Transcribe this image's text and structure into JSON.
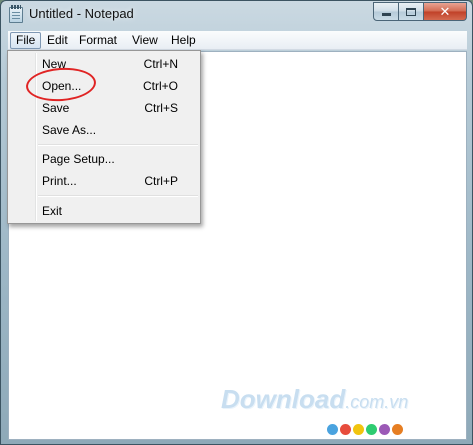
{
  "window": {
    "title": "Untitled - Notepad",
    "close_glyph": "✕"
  },
  "menubar": {
    "items": [
      "File",
      "Edit",
      "Format",
      "View",
      "Help"
    ],
    "active": "File"
  },
  "file_menu": {
    "items": [
      {
        "label": "New",
        "shortcut": "Ctrl+N"
      },
      {
        "label": "Open...",
        "shortcut": "Ctrl+O"
      },
      {
        "label": "Save",
        "shortcut": "Ctrl+S"
      },
      {
        "label": "Save As...",
        "shortcut": ""
      },
      {
        "label": "Page Setup...",
        "shortcut": ""
      },
      {
        "label": "Print...",
        "shortcut": "Ctrl+P"
      },
      {
        "label": "Exit",
        "shortcut": ""
      }
    ]
  },
  "annotation": {
    "highlighted_item": "Open...",
    "color": "#e02424"
  },
  "watermark": {
    "brand": "Download",
    "domain": ".com.vn",
    "dot_colors": [
      "#4aa3df",
      "#e74c3c",
      "#f1c40f",
      "#2ecc71",
      "#9b59b6",
      "#e67e22"
    ]
  }
}
